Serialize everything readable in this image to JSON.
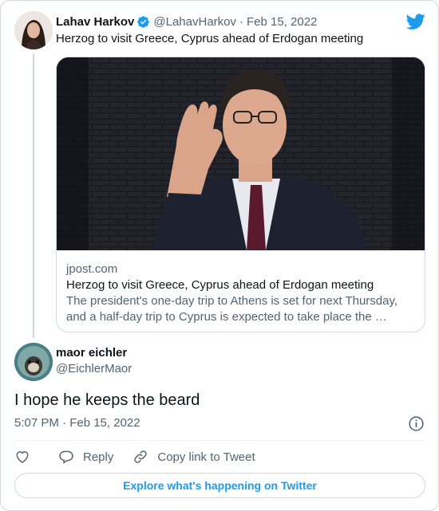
{
  "quoted_tweet": {
    "author_name": "Lahav Harkov",
    "handle": "@LahavHarkov",
    "date_separator": "·",
    "date": "Feb 15, 2022",
    "text": "Herzog to visit Greece, Cyprus ahead of Erdogan meeting",
    "verified": true,
    "link_card": {
      "domain": "jpost.com",
      "title": "Herzog to visit Greece, Cyprus ahead of Erdogan meeting",
      "description": "The president's one-day trip to Athens is set for next Thursday, and a half-day trip to Cyprus is expected to take place the …",
      "image_icon": "photo-of-man-waving"
    }
  },
  "reply_tweet": {
    "author_name": "maor eichler",
    "handle": "@EichlerMaor",
    "text": "I hope he keeps the beard",
    "timestamp": "5:07 PM · Feb 15, 2022"
  },
  "actions": {
    "like_icon": "heart-icon",
    "reply_label": "Reply",
    "copy_link_label": "Copy link to Tweet"
  },
  "footer": {
    "explore_label": "Explore what's happening on Twitter"
  },
  "colors": {
    "twitter_blue": "#1d9bf0",
    "text_primary": "#0f1419",
    "text_secondary": "#536471",
    "border": "#cfd9de"
  }
}
